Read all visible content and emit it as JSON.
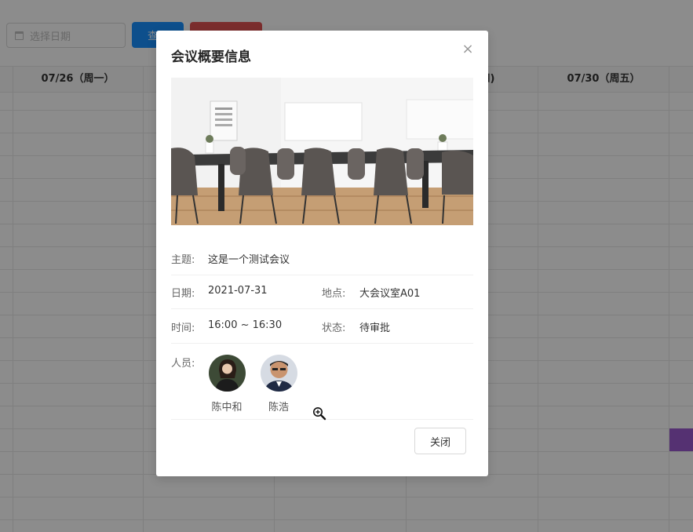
{
  "toolbar": {
    "date_placeholder": "选择日期",
    "query_label": "查询",
    "red_label": ""
  },
  "calendar": {
    "headers": [
      {
        "label": "07/26（周一）"
      },
      {
        "label": ""
      },
      {
        "label": ""
      },
      {
        "label": "四)"
      },
      {
        "label": "07/30（周五）"
      }
    ],
    "event_color": "#9b59d0"
  },
  "modal": {
    "title": "会议概要信息",
    "close_symbol": "×",
    "photo_icon": "conference-room-photo",
    "fields": {
      "subject_label": "主题:",
      "subject_value": "这是一个测试会议",
      "date_label": "日期:",
      "date_value": "2021-07-31",
      "location_label": "地点:",
      "location_value": "大会议室A01",
      "time_label": "时间:",
      "time_value": "16:00 ~ 16:30",
      "status_label": "状态:",
      "status_value": "待审批",
      "people_label": "人员:"
    },
    "people": [
      {
        "name": "陈中和"
      },
      {
        "name": "陈浩"
      }
    ],
    "close_button_label": "关闭"
  },
  "colors": {
    "primary": "#1890ff",
    "danger": "#e05252",
    "mask": "rgba(0,0,0,0.45)"
  }
}
